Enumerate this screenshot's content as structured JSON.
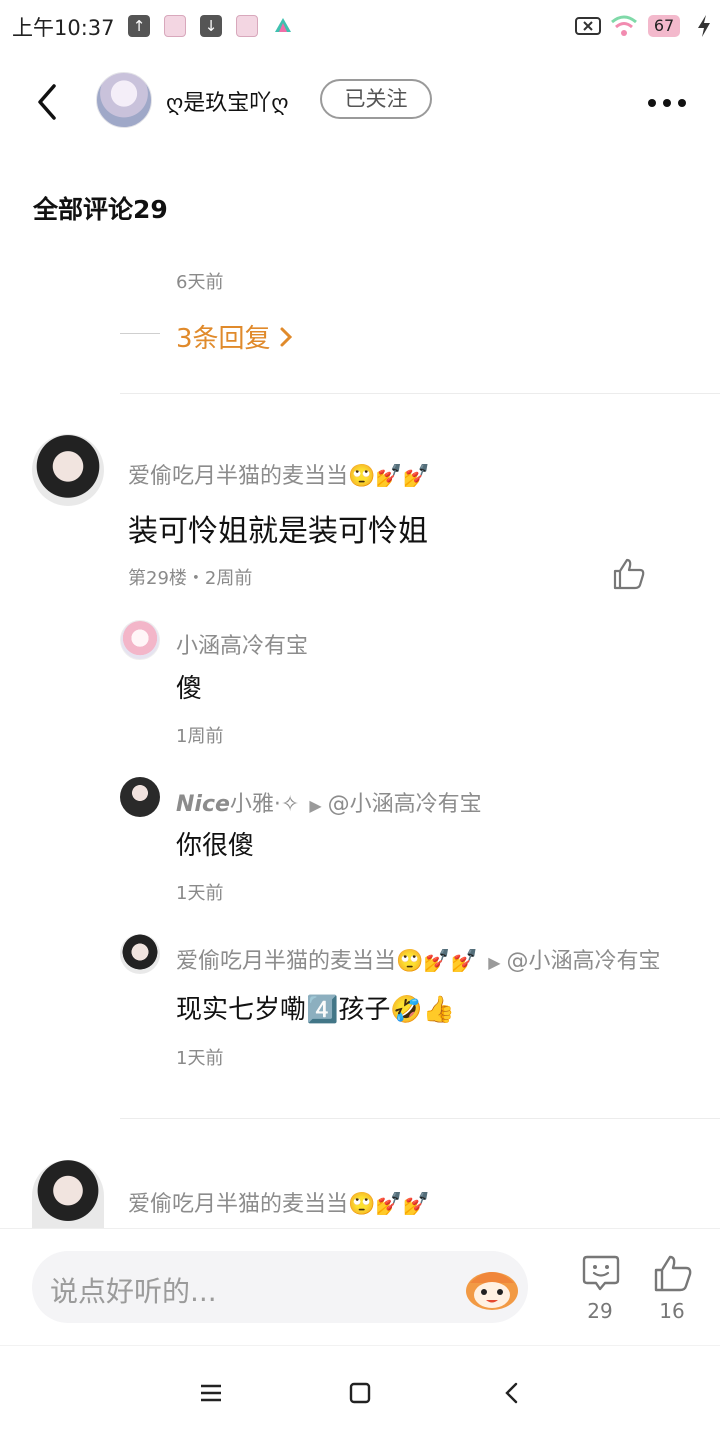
{
  "status_bar": {
    "time": "上午10:37",
    "battery": "67"
  },
  "header": {
    "author_name": "ღ是玖宝吖ღ",
    "follow_label": "已关注"
  },
  "comments_section": {
    "title": "全部评论29"
  },
  "previous_comment": {
    "time": "6天前",
    "reply_count_label": "3条回复"
  },
  "comment": {
    "username": "爱偷吃月半猫的麦当当🙄💅💅",
    "text": "装可怜姐就是装可怜姐",
    "meta": "第29楼・2周前",
    "replies": [
      {
        "username": "小涵高冷有宝",
        "text": "傻",
        "time": "1周前"
      },
      {
        "username_bold": "Nice",
        "username_rest": "小雅·✧",
        "reply_to": "@小涵高冷有宝",
        "text": "你很傻",
        "time": "1天前"
      },
      {
        "username": "爱偷吃月半猫的麦当当🙄💅💅",
        "reply_to": "@小涵高冷有宝",
        "text": "现实七岁嘞4️⃣孩子🤣👍",
        "time": "1天前"
      }
    ]
  },
  "next_comment": {
    "username": "爱偷吃月半猫的麦当当🙄💅💅"
  },
  "input_bar": {
    "placeholder": "说点好听的...",
    "comment_count": "29",
    "like_count": "16"
  },
  "colors": {
    "accent": "#e08a2b",
    "muted_text": "#8a8a8a"
  }
}
